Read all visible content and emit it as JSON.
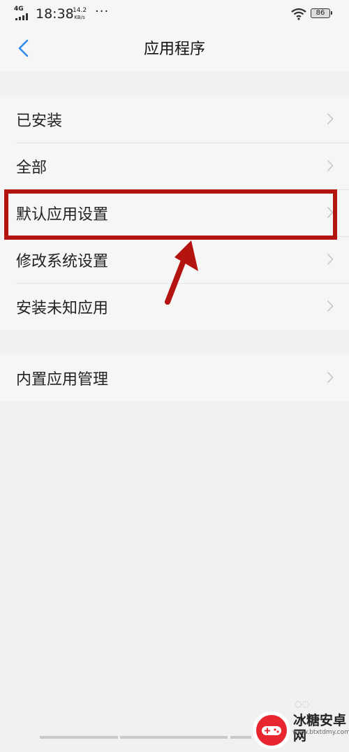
{
  "status_bar": {
    "network": "4G",
    "time": "18:38",
    "speed_value": "14.2",
    "speed_unit": "KB/s",
    "more": "···",
    "battery": "86"
  },
  "header": {
    "title": "应用程序",
    "back_icon": "chevron-left-icon"
  },
  "groups": [
    {
      "items": [
        "已安装",
        "全部",
        "默认应用设置",
        "修改系统设置",
        "安装未知应用"
      ]
    },
    {
      "items": [
        "内置应用管理"
      ]
    }
  ],
  "highlighted_item": "默认应用设置",
  "watermark": {
    "text": "冰糖安卓网",
    "url": "www.btxtdmy.com"
  },
  "colors": {
    "accent": "#2d8cf0",
    "highlight": "#b3140f",
    "background": "#f1f1f1",
    "panel": "#f6f6f6"
  }
}
